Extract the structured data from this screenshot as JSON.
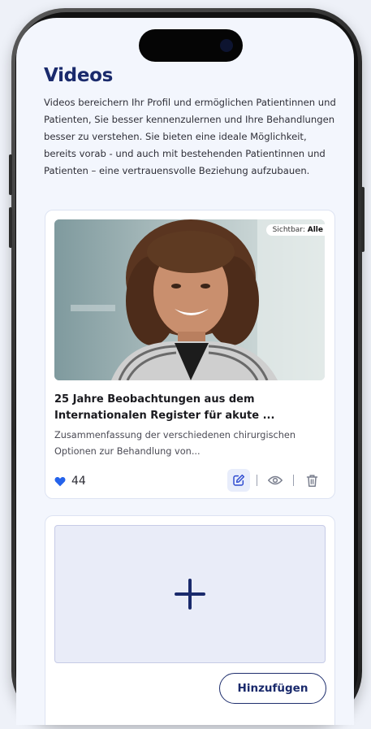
{
  "page": {
    "title": "Videos",
    "intro": "Videos bereichern Ihr Profil und ermöglichen Patientinnen und Patienten, Sie besser kennenzulernen und Ihre Behandlungen besser zu verstehen. Sie bieten eine ideale Möglichkeit, bereits vorab - und auch mit bestehenden Patientinnen und Patienten – eine vertrauensvolle Beziehung aufzubauen."
  },
  "video_card": {
    "visibility_label": "Sichtbar:",
    "visibility_value": "Alle",
    "thumbnail": "portrait of smiling woman with curly hair",
    "title": "25 Jahre Beobachtungen aus dem Internationalen Register für akute ...",
    "description": "Zusammenfassung der verschiedenen chirurgischen Optionen zur Behandlung von...",
    "likes": "44",
    "actions": {
      "edit": "edit-icon",
      "view": "eye-icon",
      "delete": "trash-icon"
    }
  },
  "add_card": {
    "plus_icon": "plus-icon",
    "button_label": "Hinzufügen"
  },
  "colors": {
    "brand": "#1a2a6c",
    "like": "#2563eb",
    "background": "#f3f6fd"
  }
}
